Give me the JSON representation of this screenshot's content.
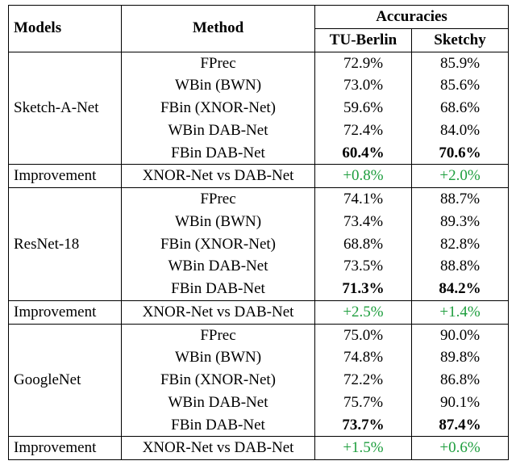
{
  "header": {
    "models": "Models",
    "method": "Method",
    "accuracies": "Accuracies",
    "tuberlin": "TU-Berlin",
    "sketchy": "Sketchy"
  },
  "blocks": [
    {
      "model": "Sketch-A-Net",
      "rows": [
        {
          "method": "FPrec",
          "tub": "72.9%",
          "sk": "85.9%",
          "bold": false
        },
        {
          "method": "WBin (BWN)",
          "tub": "73.0%",
          "sk": "85.6%",
          "bold": false
        },
        {
          "method": "FBin (XNOR-Net)",
          "tub": "59.6%",
          "sk": "68.6%",
          "bold": false
        },
        {
          "method": "WBin DAB-Net",
          "tub": "72.4%",
          "sk": "84.0%",
          "bold": false
        },
        {
          "method": "FBin DAB-Net",
          "tub": "60.4%",
          "sk": "70.6%",
          "bold": true
        }
      ],
      "improvement": {
        "label": "Improvement",
        "method": "XNOR-Net vs DAB-Net",
        "tub": "+0.8%",
        "sk": "+2.0%"
      }
    },
    {
      "model": "ResNet-18",
      "rows": [
        {
          "method": "FPrec",
          "tub": "74.1%",
          "sk": "88.7%",
          "bold": false
        },
        {
          "method": "WBin (BWN)",
          "tub": "73.4%",
          "sk": "89.3%",
          "bold": false
        },
        {
          "method": "FBin (XNOR-Net)",
          "tub": "68.8%",
          "sk": "82.8%",
          "bold": false
        },
        {
          "method": "WBin DAB-Net",
          "tub": "73.5%",
          "sk": "88.8%",
          "bold": false
        },
        {
          "method": "FBin DAB-Net",
          "tub": "71.3%",
          "sk": "84.2%",
          "bold": true
        }
      ],
      "improvement": {
        "label": "Improvement",
        "method": "XNOR-Net vs DAB-Net",
        "tub": "+2.5%",
        "sk": "+1.4%"
      }
    },
    {
      "model": "GoogleNet",
      "rows": [
        {
          "method": "FPrec",
          "tub": "75.0%",
          "sk": "90.0%",
          "bold": false
        },
        {
          "method": "WBin (BWN)",
          "tub": "74.8%",
          "sk": "89.8%",
          "bold": false
        },
        {
          "method": "FBin (XNOR-Net)",
          "tub": "72.2%",
          "sk": "86.8%",
          "bold": false
        },
        {
          "method": "WBin DAB-Net",
          "tub": "75.7%",
          "sk": "90.1%",
          "bold": false
        },
        {
          "method": "FBin DAB-Net",
          "tub": "73.7%",
          "sk": "87.4%",
          "bold": true
        }
      ],
      "improvement": {
        "label": "Improvement",
        "method": "XNOR-Net vs DAB-Net",
        "tub": "+1.5%",
        "sk": "+0.6%"
      }
    }
  ],
  "chart_data": {
    "type": "table",
    "columns": [
      "Model",
      "Method",
      "TU-Berlin Accuracy (%)",
      "Sketchy Accuracy (%)"
    ],
    "rows": [
      [
        "Sketch-A-Net",
        "FPrec",
        72.9,
        85.9
      ],
      [
        "Sketch-A-Net",
        "WBin (BWN)",
        73.0,
        85.6
      ],
      [
        "Sketch-A-Net",
        "FBin (XNOR-Net)",
        59.6,
        68.6
      ],
      [
        "Sketch-A-Net",
        "WBin DAB-Net",
        72.4,
        84.0
      ],
      [
        "Sketch-A-Net",
        "FBin DAB-Net",
        60.4,
        70.6
      ],
      [
        "Sketch-A-Net",
        "XNOR-Net vs DAB-Net (Δ)",
        0.8,
        2.0
      ],
      [
        "ResNet-18",
        "FPrec",
        74.1,
        88.7
      ],
      [
        "ResNet-18",
        "WBin (BWN)",
        73.4,
        89.3
      ],
      [
        "ResNet-18",
        "FBin (XNOR-Net)",
        68.8,
        82.8
      ],
      [
        "ResNet-18",
        "WBin DAB-Net",
        73.5,
        88.8
      ],
      [
        "ResNet-18",
        "FBin DAB-Net",
        71.3,
        84.2
      ],
      [
        "ResNet-18",
        "XNOR-Net vs DAB-Net (Δ)",
        2.5,
        1.4
      ],
      [
        "GoogleNet",
        "FPrec",
        75.0,
        90.0
      ],
      [
        "GoogleNet",
        "WBin (BWN)",
        74.8,
        89.8
      ],
      [
        "GoogleNet",
        "FBin (XNOR-Net)",
        72.2,
        86.8
      ],
      [
        "GoogleNet",
        "WBin DAB-Net",
        75.7,
        90.1
      ],
      [
        "GoogleNet",
        "FBin DAB-Net",
        73.7,
        87.4
      ],
      [
        "GoogleNet",
        "XNOR-Net vs DAB-Net (Δ)",
        1.5,
        0.6
      ]
    ]
  }
}
